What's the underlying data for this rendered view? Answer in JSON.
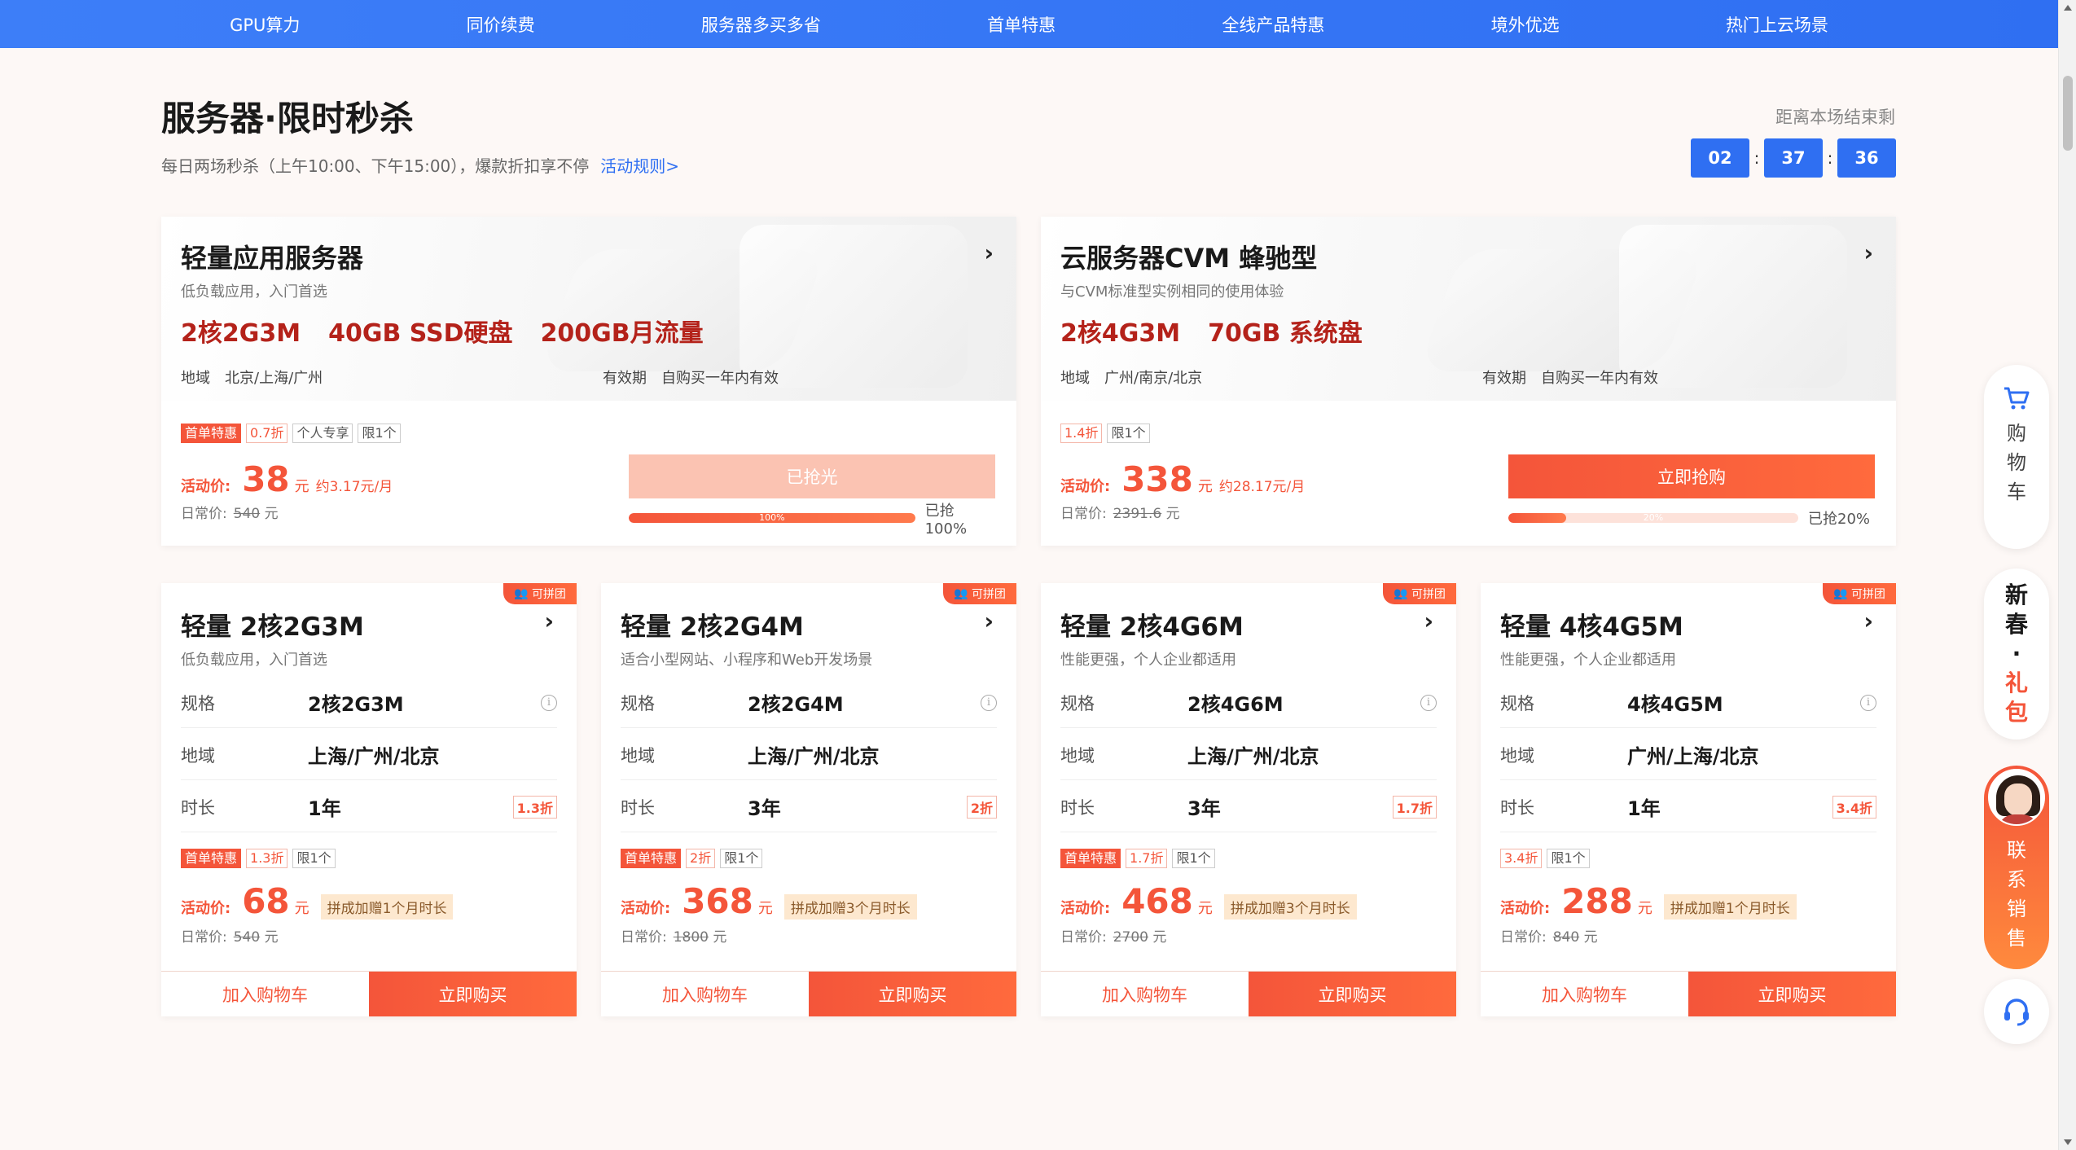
{
  "nav": [
    "GPU算力",
    "同价续费",
    "服务器多买多省",
    "首单特惠",
    "全线产品特惠",
    "境外优选",
    "热门上云场景"
  ],
  "header": {
    "title": "服务器·限时秒杀",
    "subtitle": "每日两场秒杀（上午10:00、下午15:00），爆款折扣享不停",
    "rules_link": "活动规则>",
    "countdown_label": "距离本场结束剩",
    "countdown": [
      "02",
      "37",
      "36"
    ],
    "countdown_sep": ":"
  },
  "labels": {
    "region": "地域",
    "validity": "有效期",
    "spec": "规格",
    "duration": "时长",
    "price_label": "活动价:",
    "orig_label": "日常价:",
    "yuan": "元",
    "add_cart": "加入购物车",
    "buy_now": "立即购买",
    "group_badge": "可拼团",
    "first_order": "首单特惠"
  },
  "big_cards": [
    {
      "title": "轻量应用服务器",
      "desc": "低负载应用，入门首选",
      "specs": [
        "2核2G3M",
        "40GB SSD硬盘",
        "200GB月流量"
      ],
      "region": "北京/上海/广州",
      "validity": "自购买一年内有效",
      "tags": [
        "首单特惠",
        "0.7折",
        "个人专享",
        "限1个"
      ],
      "price": "38",
      "monthly": "约3.17元/月",
      "orig": "540",
      "cta": "已抢光",
      "cta_state": "soldout",
      "progress_pct": 100,
      "progress_inner": "100%",
      "progress_text": "已抢100%"
    },
    {
      "title": "云服务器CVM 蜂驰型",
      "desc": "与CVM标准型实例相同的使用体验",
      "specs": [
        "2核4G3M",
        "70GB 系统盘"
      ],
      "region": "广州/南京/北京",
      "validity": "自购买一年内有效",
      "tags": [
        "1.4折",
        "限1个"
      ],
      "price": "338",
      "monthly": "约28.17元/月",
      "orig": "2391.6",
      "cta": "立即抢购",
      "cta_state": "active",
      "progress_pct": 20,
      "progress_inner": "20%",
      "progress_text": "已抢20%"
    }
  ],
  "small_cards": [
    {
      "title": "轻量 2核2G3M",
      "desc": "低负载应用，入门首选",
      "spec": "2核2G3M",
      "region": "上海/广州/北京",
      "duration": "1年",
      "duration_disc": "1.3折",
      "tags": [
        "首单特惠",
        "1.3折",
        "限1个"
      ],
      "price": "68",
      "bonus": "拼成加赠1个月时长",
      "orig": "540"
    },
    {
      "title": "轻量 2核2G4M",
      "desc": "适合小型网站、小程序和Web开发场景",
      "spec": "2核2G4M",
      "region": "上海/广州/北京",
      "duration": "3年",
      "duration_disc": "2折",
      "tags": [
        "首单特惠",
        "2折",
        "限1个"
      ],
      "price": "368",
      "bonus": "拼成加赠3个月时长",
      "orig": "1800"
    },
    {
      "title": "轻量 2核4G6M",
      "desc": "性能更强，个人企业都适用",
      "spec": "2核4G6M",
      "region": "上海/广州/北京",
      "duration": "3年",
      "duration_disc": "1.7折",
      "tags": [
        "首单特惠",
        "1.7折",
        "限1个"
      ],
      "price": "468",
      "bonus": "拼成加赠3个月时长",
      "orig": "2700"
    },
    {
      "title": "轻量 4核4G5M",
      "desc": "性能更强，个人企业都适用",
      "spec": "4核4G5M",
      "region": "广州/上海/北京",
      "duration": "1年",
      "duration_disc": "3.4折",
      "tags": [
        "3.4折",
        "限1个"
      ],
      "price": "288",
      "bonus": "拼成加赠1个月时长",
      "orig": "840"
    }
  ],
  "float": {
    "cart": [
      "购",
      "物",
      "车"
    ],
    "gift": [
      "新",
      "春",
      "·",
      "礼",
      "包"
    ],
    "sales": [
      "联",
      "系",
      "销",
      "售"
    ]
  },
  "colors": {
    "brand_blue": "#2f6ff2",
    "accent_orange": "#f4553a",
    "spec_red": "#b4221a"
  },
  "icons": [
    "cart-icon",
    "headset-icon",
    "chevron-right-icon",
    "info-icon",
    "user-icon"
  ]
}
